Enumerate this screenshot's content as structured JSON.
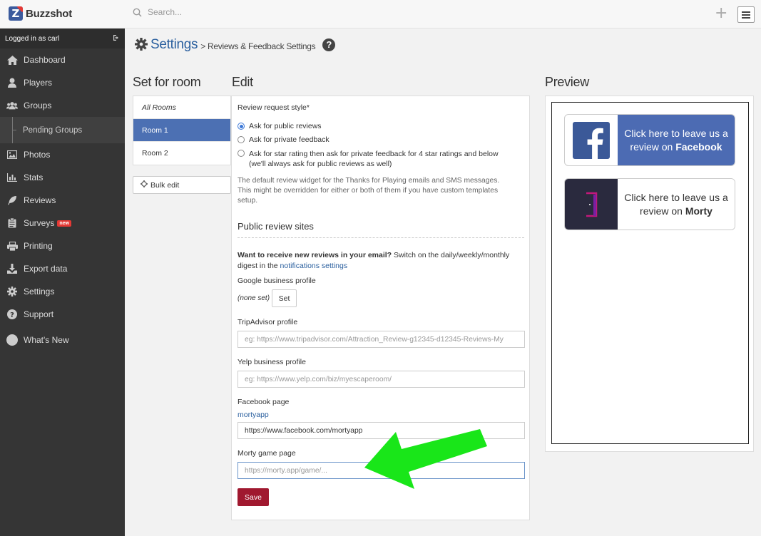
{
  "app": {
    "name": "Buzzshot",
    "search_placeholder": "Search...",
    "accent": "#4c70b3",
    "save_color": "#a0182f"
  },
  "sidebar": {
    "logged_in": "Logged in as carl",
    "items": [
      {
        "label": "Dashboard",
        "icon": "home-icon"
      },
      {
        "label": "Players",
        "icon": "user-icon"
      },
      {
        "label": "Groups",
        "icon": "users-icon"
      },
      {
        "label": "Pending Groups",
        "icon": ""
      },
      {
        "label": "Photos",
        "icon": "image-icon"
      },
      {
        "label": "Stats",
        "icon": "bar-chart-icon"
      },
      {
        "label": "Reviews",
        "icon": "feather-icon"
      },
      {
        "label": "Surveys",
        "icon": "clipboard-icon",
        "badge": "new"
      },
      {
        "label": "Printing",
        "icon": "printer-icon"
      },
      {
        "label": "Export data",
        "icon": "download-icon"
      },
      {
        "label": "Settings",
        "icon": "gear-icon"
      },
      {
        "label": "Support",
        "icon": "question-icon"
      },
      {
        "label": "What's New",
        "icon": "circle-icon"
      }
    ]
  },
  "breadcrumb": {
    "main": "Settings",
    "sub": "> Reviews & Feedback Settings",
    "help": "?"
  },
  "room_panel": {
    "title": "Set for room",
    "rooms": [
      "All Rooms",
      "Room 1",
      "Room 2"
    ],
    "bulk_edit": "Bulk edit"
  },
  "edit": {
    "title": "Edit",
    "style_label": "Review request style*",
    "options": [
      "Ask for public reviews",
      "Ask for private feedback",
      "Ask for star rating then ask for private feedback for 4 star ratings and below",
      "(we'll always ask for public reviews as well)"
    ],
    "default_help_1": "The default review widget for the Thanks for Playing emails and SMS messages.",
    "default_help_2": "This might be overridden for either or both of them if you have custom templates",
    "default_help_3": "setup.",
    "public_sites": "Public review sites",
    "email_bold": "Want to receive new reviews in your email?",
    "email_rest": " Switch on the daily/weekly/monthly",
    "email_line2": "digest in the ",
    "email_link": "notifications settings",
    "google_label": "Google business profile",
    "google_value": "(none set)",
    "set_button": "Set",
    "tripadvisor_label": "TripAdvisor profile",
    "tripadvisor_placeholder": "eg: https://www.tripadvisor.com/Attraction_Review-g12345-d12345-Reviews-My",
    "yelp_label": "Yelp business profile",
    "yelp_placeholder": "eg: https://www.yelp.com/biz/myescaperoom/",
    "facebook_label": "Facebook page",
    "facebook_link": "mortyapp",
    "facebook_value": "https://www.facebook.com/mortyapp",
    "morty_label": "Morty game page",
    "morty_placeholder": "https://morty.app/game/...",
    "save": "Save"
  },
  "preview": {
    "title": "Preview",
    "facebook_line1": "Click here to leave us a",
    "facebook_line2_pre": "review on ",
    "facebook_line2_bold": "Facebook",
    "morty_line1": "Click here to leave us a",
    "morty_line2_pre": "review on ",
    "morty_line2_bold": "Morty"
  }
}
